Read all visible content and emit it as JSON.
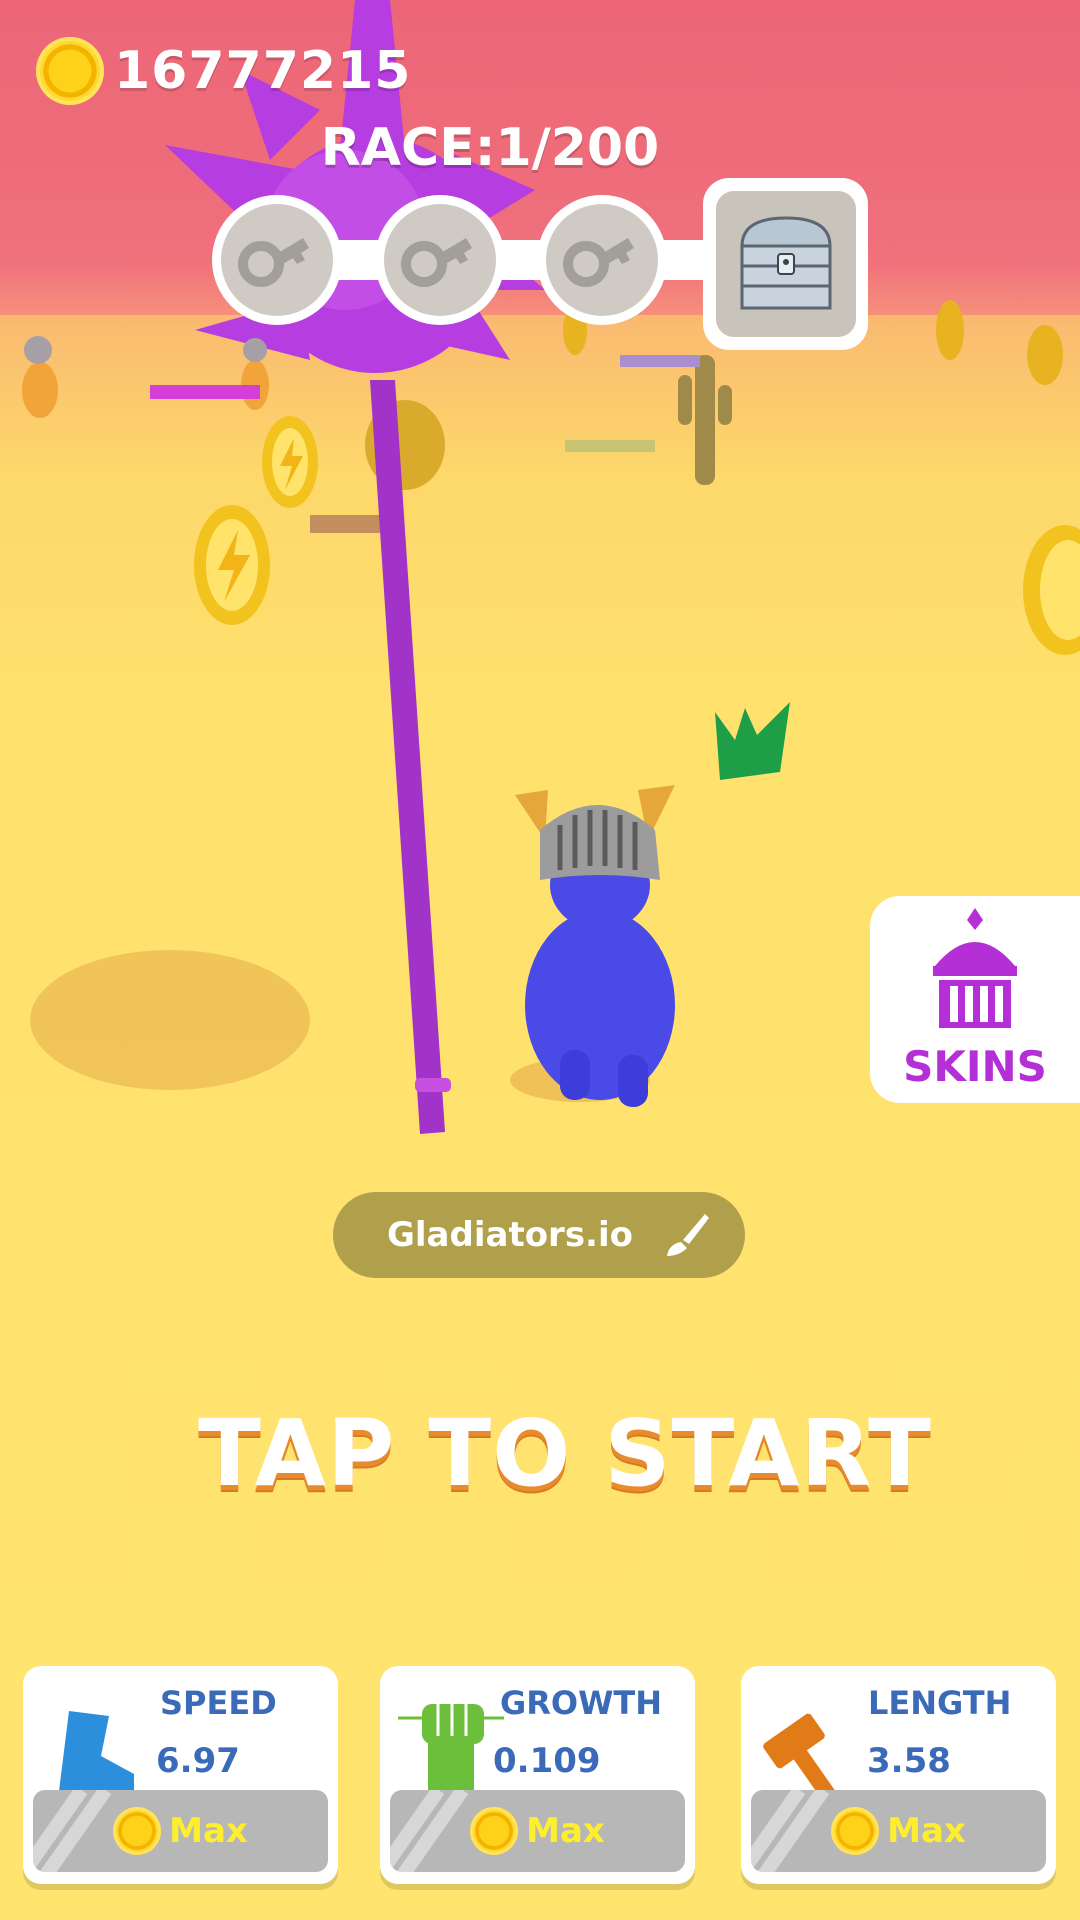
{
  "hud": {
    "coin_icon": "coin-icon",
    "coin_count": "16777215",
    "race_title": "RACE:1/200",
    "keys": [
      {
        "icon": "key-icon",
        "collected": false
      },
      {
        "icon": "key-icon",
        "collected": false
      },
      {
        "icon": "key-icon",
        "collected": false
      }
    ],
    "reward_icon": "treasure-chest-icon"
  },
  "skins_button": {
    "icon": "temple-icon",
    "label": "SKINS"
  },
  "player": {
    "name": "Gladiators.io",
    "edit_icon": "brush-icon"
  },
  "start_prompt": "TAP TO START",
  "upgrades": [
    {
      "title": "SPEED",
      "value": "6.97",
      "icon": "boot-icon",
      "button_label": "Max"
    },
    {
      "title": "GROWTH",
      "value": "0.109",
      "icon": "fist-icon",
      "button_label": "Max"
    },
    {
      "title": "LENGTH",
      "value": "3.58",
      "icon": "hammer-icon",
      "button_label": "Max"
    }
  ],
  "colors": {
    "sky": "#ee6c78",
    "sand": "#ffe46f",
    "accent_purple": "#b52fd6",
    "card_text": "#3b6bb8",
    "max_text": "#ffee2e"
  }
}
